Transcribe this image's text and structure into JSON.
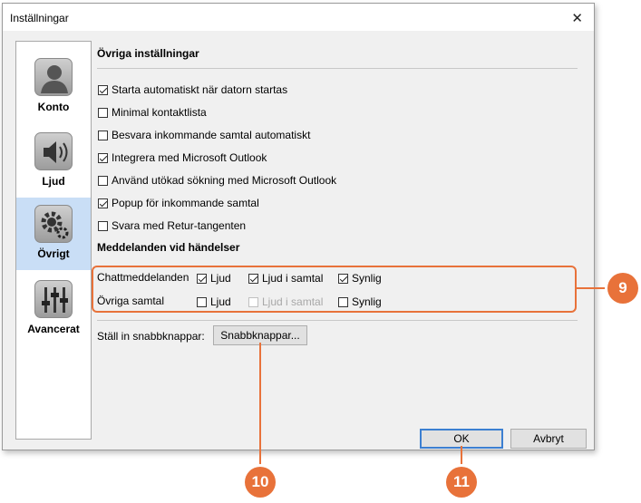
{
  "window": {
    "title": "Inställningar",
    "close_label": "✕"
  },
  "sidebar": {
    "items": [
      {
        "label": "Konto",
        "icon": "user-icon",
        "selected": false
      },
      {
        "label": "Ljud",
        "icon": "speaker-icon",
        "selected": false
      },
      {
        "label": "Övrigt",
        "icon": "gear-icon",
        "selected": true
      },
      {
        "label": "Avancerat",
        "icon": "sliders-icon",
        "selected": false
      }
    ]
  },
  "main": {
    "section_title": "Övriga inställningar",
    "options": [
      {
        "label": "Starta automatiskt när datorn startas",
        "checked": true
      },
      {
        "label": "Minimal kontaktlista",
        "checked": false
      },
      {
        "label": "Besvara inkommande samtal automatiskt",
        "checked": false
      },
      {
        "label": "Integrera med Microsoft Outlook",
        "checked": true
      },
      {
        "label": "Använd utökad sökning med Microsoft Outlook",
        "checked": false
      },
      {
        "label": "Popup för inkommande samtal",
        "checked": true
      },
      {
        "label": "Svara med Retur-tangenten",
        "checked": false
      }
    ],
    "events_title": "Meddelanden vid händelser",
    "events": [
      {
        "label": "Chattmeddelanden",
        "sound": {
          "label": "Ljud",
          "checked": true
        },
        "in_call": {
          "label": "Ljud i samtal",
          "checked": true,
          "disabled": false
        },
        "visible": {
          "label": "Synlig",
          "checked": true
        }
      },
      {
        "label": "Övriga samtal",
        "sound": {
          "label": "Ljud",
          "checked": false
        },
        "in_call": {
          "label": "Ljud i samtal",
          "checked": false,
          "disabled": true
        },
        "visible": {
          "label": "Synlig",
          "checked": false
        }
      }
    ],
    "shortcuts_label": "Ställ in snabbknappar:",
    "shortcuts_button": "Snabbknappar..."
  },
  "footer": {
    "ok_label": "OK",
    "cancel_label": "Avbryt"
  },
  "callouts": {
    "c9": "9",
    "c10": "10",
    "c11": "11"
  },
  "colors": {
    "accent": "#e8723a",
    "selected_bg": "#c9def6",
    "default_button_border": "#3c7fd1"
  }
}
